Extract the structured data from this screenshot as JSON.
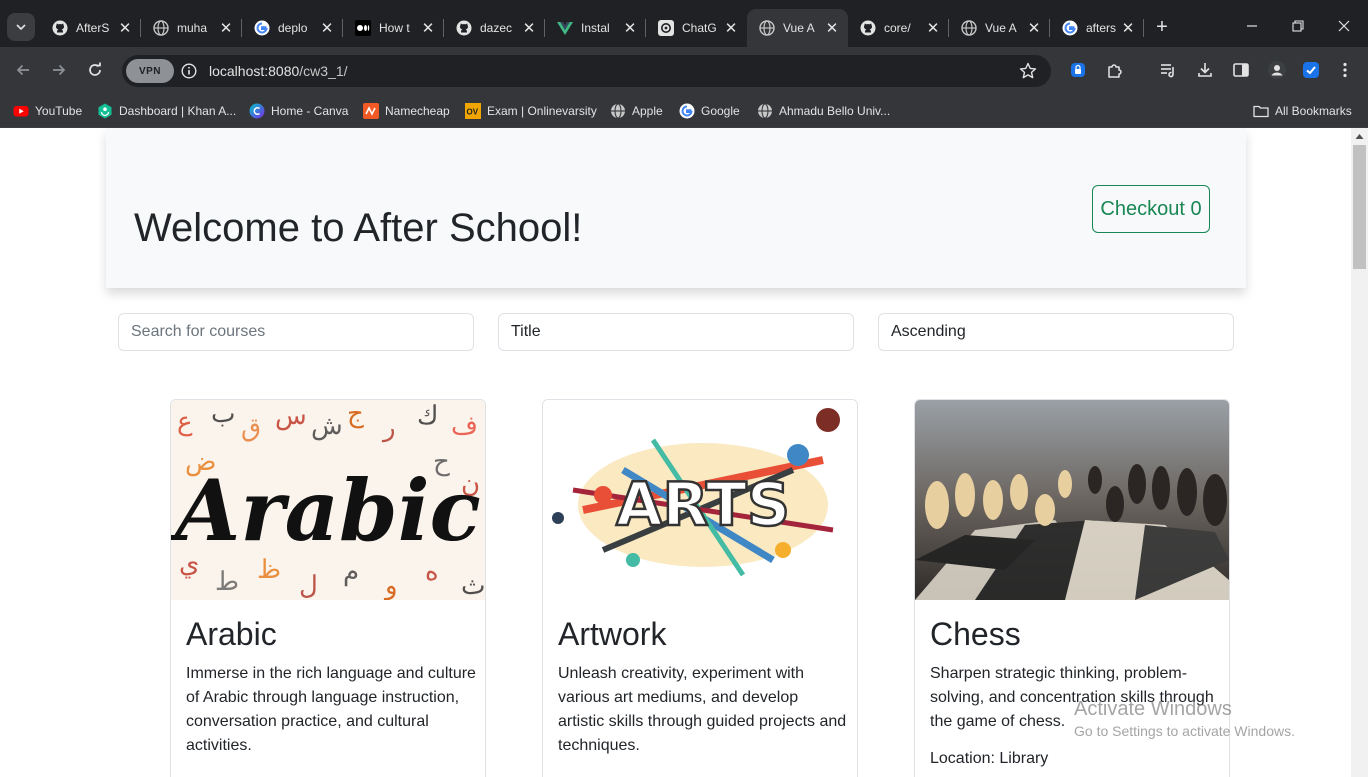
{
  "browser": {
    "tabs": [
      {
        "label": "AfterS",
        "icon": "github-icon"
      },
      {
        "label": "muha",
        "icon": "globe-icon"
      },
      {
        "label": "deplo",
        "icon": "google-icon"
      },
      {
        "label": "How t",
        "icon": "medium-icon"
      },
      {
        "label": "dazec",
        "icon": "github-icon"
      },
      {
        "label": "Instal",
        "icon": "vue-icon"
      },
      {
        "label": "ChatG",
        "icon": "openai-icon"
      },
      {
        "label": "Vue A",
        "icon": "globe-icon",
        "active": true
      },
      {
        "label": "core/",
        "icon": "github-icon"
      },
      {
        "label": "Vue A",
        "icon": "globe-icon"
      },
      {
        "label": "afters",
        "icon": "google-icon"
      }
    ],
    "vpn_label": "VPN",
    "url_host": "localhost:8080",
    "url_path": "/cw3_1/",
    "bookmarks": [
      {
        "label": "YouTube",
        "icon": "youtube-icon"
      },
      {
        "label": "Dashboard | Khan A...",
        "icon": "khan-academy-icon"
      },
      {
        "label": "Home - Canva",
        "icon": "canva-icon"
      },
      {
        "label": "Namecheap",
        "icon": "namecheap-icon"
      },
      {
        "label": "Exam | Onlinevarsity",
        "icon": "onlinevarsity-icon"
      },
      {
        "label": "Apple",
        "icon": "globe-icon"
      },
      {
        "label": "Google",
        "icon": "google-icon"
      },
      {
        "label": "Ahmadu Bello Univ...",
        "icon": "globe-icon"
      }
    ],
    "all_bookmarks_label": "All Bookmarks"
  },
  "page": {
    "title": "Welcome to After School!",
    "checkout_label": "Checkout 0",
    "search_placeholder": "Search for courses",
    "sort_field": "Title",
    "sort_order": "Ascending",
    "courses": [
      {
        "title": "Arabic",
        "description": "Immerse in the rich language and culture of Arabic through language instruction, conversation practice, and cultural activities.",
        "image": "arabic-calligraphy-image"
      },
      {
        "title": "Artwork",
        "description": "Unleash creativity, experiment with various art mediums, and develop artistic skills through guided projects and techniques.",
        "image": "arts-splash-image"
      },
      {
        "title": "Chess",
        "description": "Sharpen strategic thinking, problem-solving, and concentration skills through the game of chess.",
        "location": "Location: Library",
        "image": "chessboard-image"
      }
    ]
  },
  "os_overlay": {
    "line1": "Activate Windows",
    "line2": "Go to Settings to activate Windows."
  },
  "colors": {
    "accent": "#198754",
    "hero_bg": "#f8f9fa",
    "chrome_dark": "#202124",
    "chrome_toolbar": "#35363a"
  }
}
